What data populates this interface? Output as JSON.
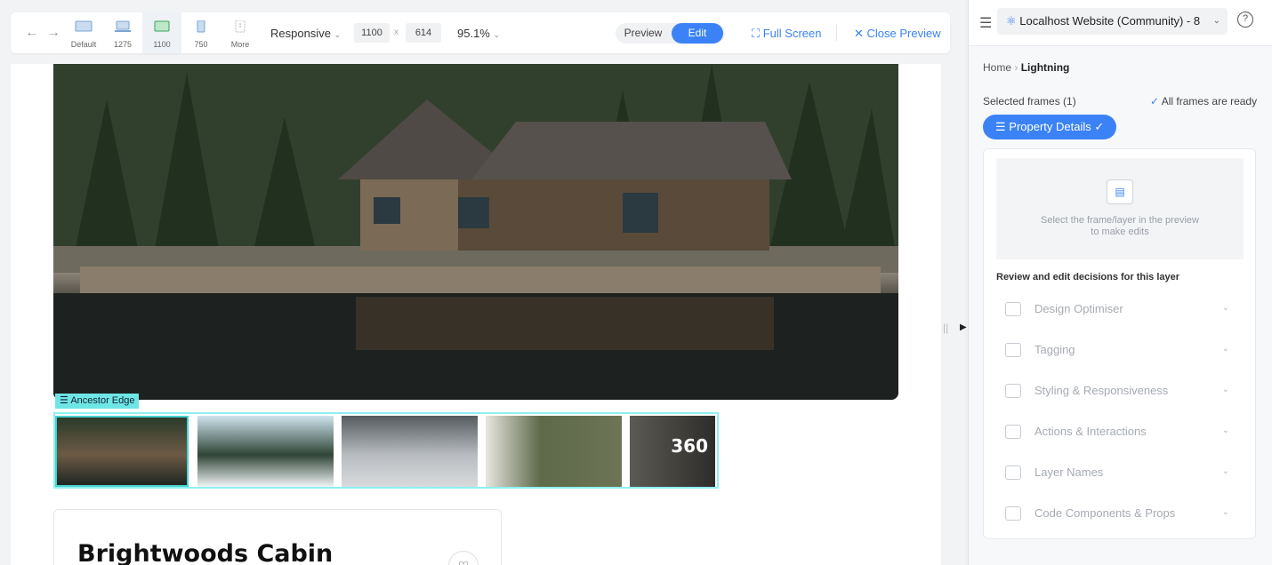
{
  "toolbar": {
    "devices": [
      {
        "label": "Default"
      },
      {
        "label": "1275"
      },
      {
        "label": "1100"
      },
      {
        "label": "750"
      },
      {
        "label": "More"
      }
    ],
    "responsive_label": "Responsive",
    "width": "1100",
    "times": "x",
    "height": "614",
    "zoom": "95.1%",
    "preview_label": "Preview",
    "edit_label": "Edit",
    "fullscreen_label": "Full Screen",
    "close_preview_label": "Close Preview"
  },
  "canvas": {
    "ancestor_label": "Ancestor Edge",
    "thumb_badge": "360",
    "property_title": "Brightwoods Cabin"
  },
  "panel": {
    "site_name": "Localhost Website (Community) - 8",
    "breadcrumb": {
      "home": "Home",
      "current": "Lightning"
    },
    "selected_frames": "Selected frames (1)",
    "ready_text": "All frames are ready",
    "selected_pill": "Property Details",
    "empty_text_line1": "Select the frame/layer in the preview",
    "empty_text_line2": "to make edits",
    "review_heading": "Review and edit decisions for this layer",
    "sections": [
      {
        "label": "Design Optimiser"
      },
      {
        "label": "Tagging"
      },
      {
        "label": "Styling & Responsiveness"
      },
      {
        "label": "Actions & Interactions"
      },
      {
        "label": "Layer Names"
      },
      {
        "label": "Code Components & Props"
      }
    ]
  },
  "colors": {
    "accent": "#3b82f6",
    "highlight": "#6fe6e6"
  }
}
